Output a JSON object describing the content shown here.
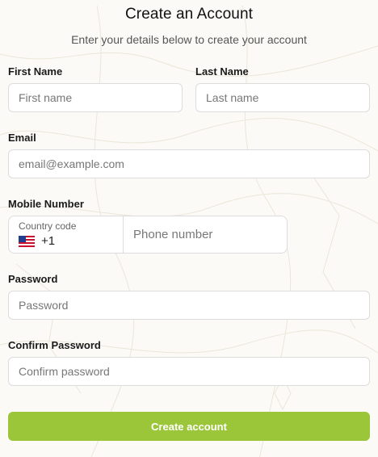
{
  "header": {
    "title": "Create an Account",
    "subtitle": "Enter your details below to create your account"
  },
  "form": {
    "first_name": {
      "label": "First Name",
      "placeholder": "First name"
    },
    "last_name": {
      "label": "Last Name",
      "placeholder": "Last name"
    },
    "email": {
      "label": "Email",
      "placeholder": "email@example.com"
    },
    "mobile": {
      "label": "Mobile Number",
      "country_code_label": "Country code",
      "country_code_value": "+1",
      "country_flag": "us-flag-icon",
      "phone_placeholder": "Phone number"
    },
    "password": {
      "label": "Password",
      "placeholder": "Password"
    },
    "confirm_password": {
      "label": "Confirm Password",
      "placeholder": "Confirm password"
    },
    "submit_label": "Create account"
  },
  "colors": {
    "accent": "#9bc63a",
    "border": "#dcdcdc",
    "background": "#fbfaf6"
  }
}
